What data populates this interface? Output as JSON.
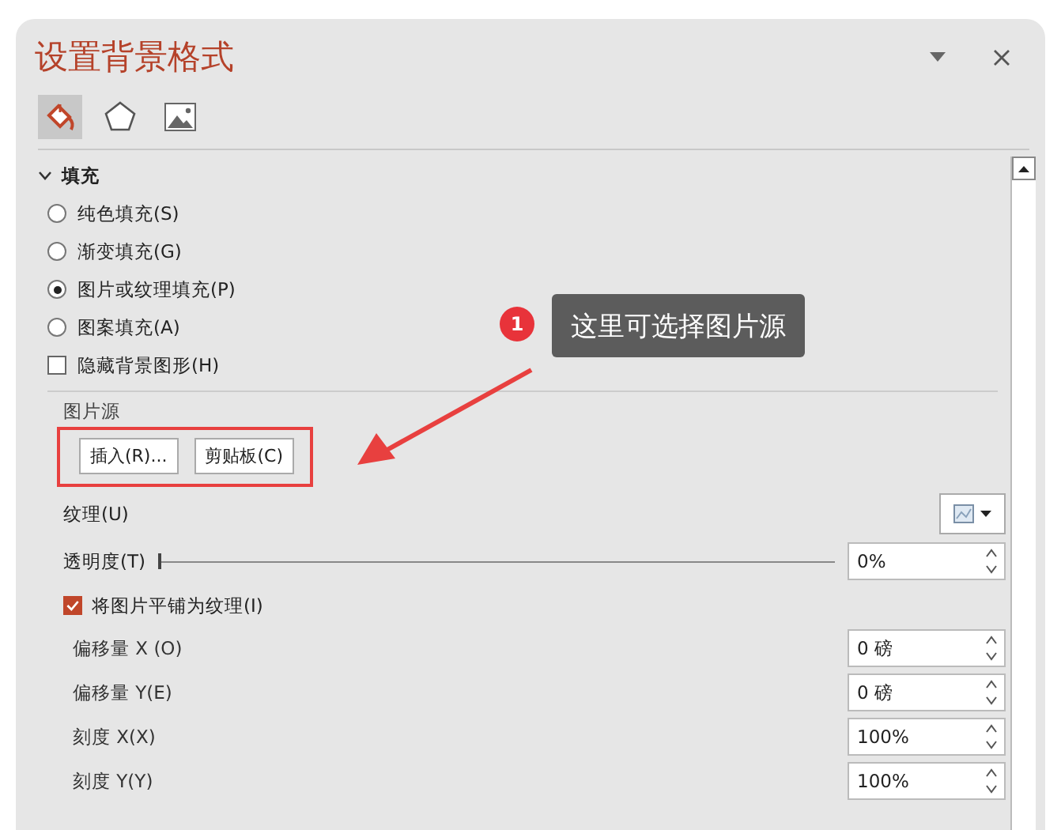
{
  "panel": {
    "title": "设置背景格式",
    "tabs": [
      {
        "kind": "fill",
        "selected": true
      },
      {
        "kind": "effects",
        "selected": false
      },
      {
        "kind": "picture",
        "selected": false
      }
    ],
    "section": {
      "title": "填充",
      "expanded": true
    },
    "fill_options": [
      {
        "label": "纯色填充(S)",
        "selected": false
      },
      {
        "label": "渐变填充(G)",
        "selected": false
      },
      {
        "label": "图片或纹理填充(P)",
        "selected": true
      },
      {
        "label": "图案填充(A)",
        "selected": false
      }
    ],
    "hide_background": {
      "label": "隐藏背景图形(H)",
      "checked": false
    },
    "picture_source": {
      "label": "图片源",
      "buttons": [
        "插入(R)...",
        "剪贴板(C)"
      ]
    },
    "texture": {
      "label": "纹理(U)"
    },
    "transparency": {
      "label": "透明度(T)",
      "level": 0,
      "value": "0%"
    },
    "tile": {
      "label": "将图片平铺为纹理(I)",
      "checked": true
    },
    "tile_fields": [
      {
        "label": "偏移量 X (O)",
        "value": "0 磅"
      },
      {
        "label": "偏移量 Y(E)",
        "value": "0 磅"
      },
      {
        "label": "刻度 X(X)",
        "value": "100%"
      },
      {
        "label": "刻度 Y(Y)",
        "value": "100%"
      }
    ]
  },
  "annotation": {
    "number": "1",
    "text": "这里可选择图片源"
  }
}
